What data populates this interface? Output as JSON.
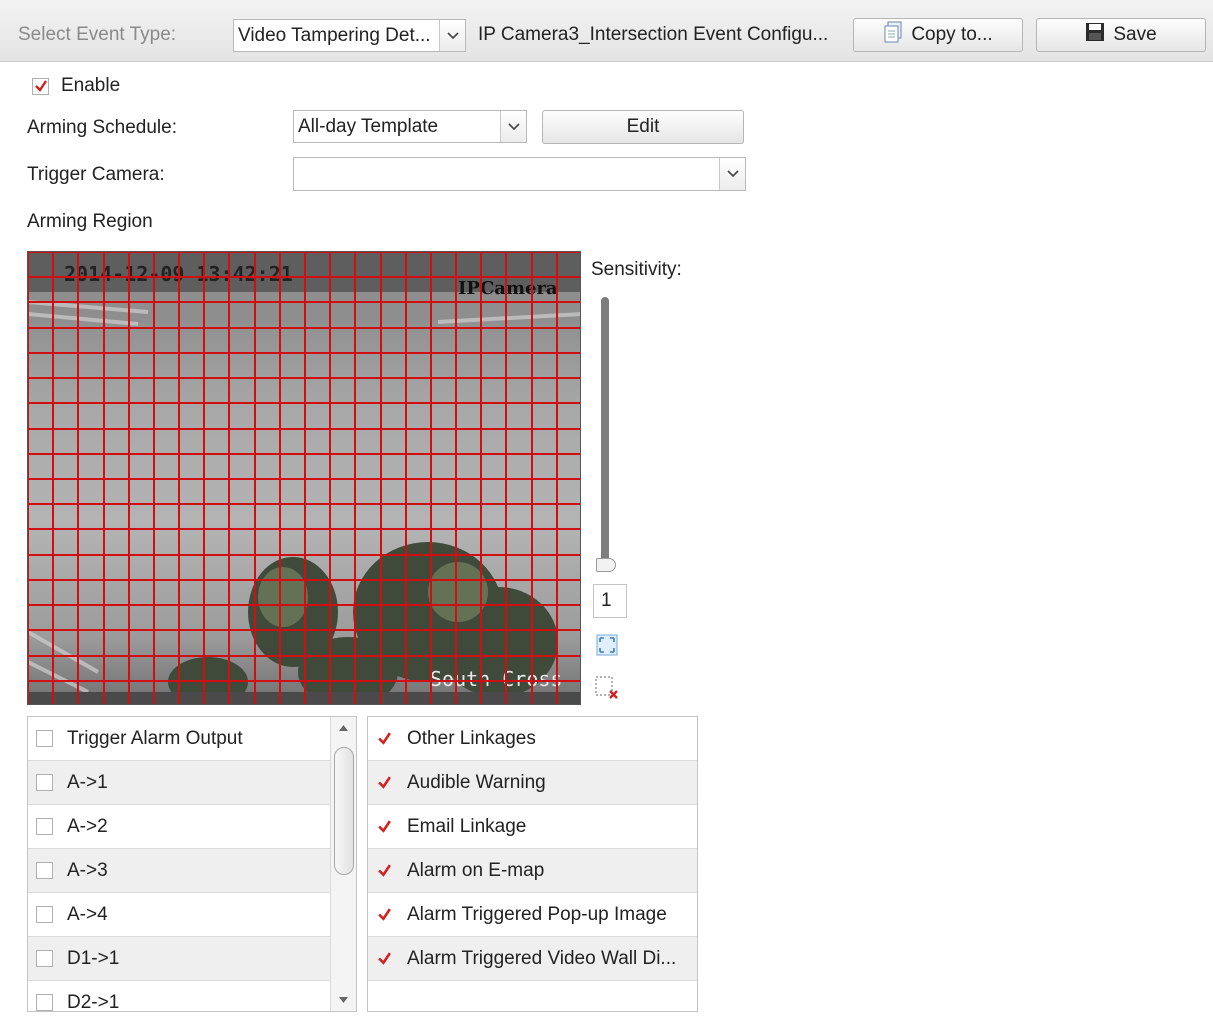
{
  "toolbar": {
    "event_type_label": "Select Event Type:",
    "event_type_value": "Video Tampering Det...",
    "config_title": "IP Camera3_Intersection Event Configu...",
    "copy_label": "Copy to...",
    "save_label": "Save"
  },
  "form": {
    "enable_label": "Enable",
    "arming_schedule_label": "Arming Schedule:",
    "arming_schedule_value": "All-day Template",
    "edit_label": "Edit",
    "trigger_camera_label": "Trigger Camera:",
    "trigger_camera_value": "",
    "arming_region_label": "Arming Region"
  },
  "video": {
    "timestamp": "2014-12-09 13:42:21",
    "camera_name": "IPCamera",
    "location": "South Cross",
    "grid_color": "#d01010"
  },
  "sensitivity": {
    "label": "Sensitivity:",
    "value": "1",
    "level": 1,
    "min": 1,
    "max": 5
  },
  "icons": {
    "draw_all": "select-all-grid-icon",
    "clear": "clear-region-icon"
  },
  "alarm_outputs": {
    "header": "Trigger Alarm Output",
    "items": [
      {
        "label": "A->1",
        "checked": false
      },
      {
        "label": "A->2",
        "checked": false
      },
      {
        "label": "A->3",
        "checked": false
      },
      {
        "label": "A->4",
        "checked": false
      },
      {
        "label": "D1->1",
        "checked": false
      },
      {
        "label": "D2->1",
        "checked": false
      }
    ]
  },
  "linkages": {
    "header": "Other Linkages",
    "items": [
      {
        "label": "Audible Warning",
        "checked": true
      },
      {
        "label": "Email Linkage",
        "checked": true
      },
      {
        "label": "Alarm on E-map",
        "checked": true
      },
      {
        "label": "Alarm Triggered Pop-up Image",
        "checked": true
      },
      {
        "label": "Alarm Triggered Video Wall Di...",
        "checked": true
      }
    ]
  },
  "colors": {
    "check": "#d02020",
    "grid": "#d01010"
  }
}
